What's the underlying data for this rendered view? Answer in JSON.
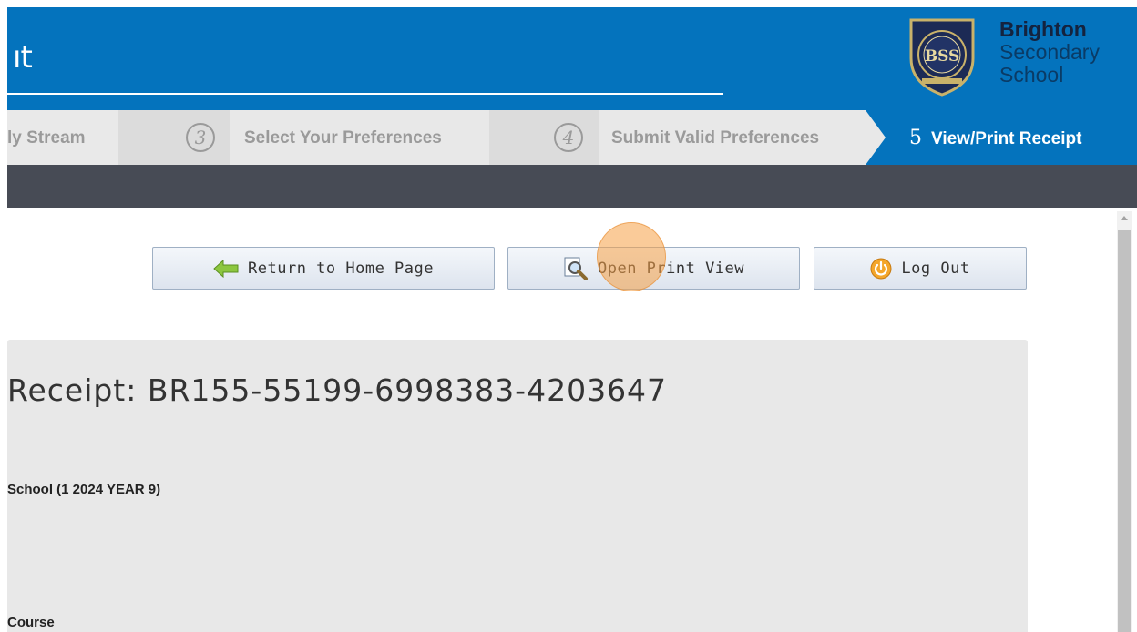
{
  "header": {
    "title_fragment": "ıt",
    "school": {
      "line1": "Brighton",
      "line2": "Secondary",
      "line3": "School"
    },
    "logo_text": "BSS"
  },
  "steps": {
    "prev_partial": "ly Stream",
    "step3": {
      "num": "3",
      "label": "Select Your Preferences"
    },
    "step4": {
      "num": "4",
      "label": "Submit Valid Preferences"
    },
    "step5": {
      "num": "5",
      "label": "View/Print Receipt"
    }
  },
  "buttons": {
    "home": {
      "label": "Return to Home Page",
      "icon": "arrow-left-icon"
    },
    "print": {
      "label": "Open Print View",
      "icon": "magnifier-icon"
    },
    "logout": {
      "label": "Log Out",
      "icon": "power-icon"
    }
  },
  "receipt": {
    "title": "Receipt: BR155-55199-6998383-4203647",
    "school_line": "School (1 2024 YEAR 9)",
    "course_line": "Course"
  },
  "colors": {
    "brand_blue": "#0473bd",
    "dark_bar": "#474b55",
    "panel": "#e8e8e8"
  }
}
